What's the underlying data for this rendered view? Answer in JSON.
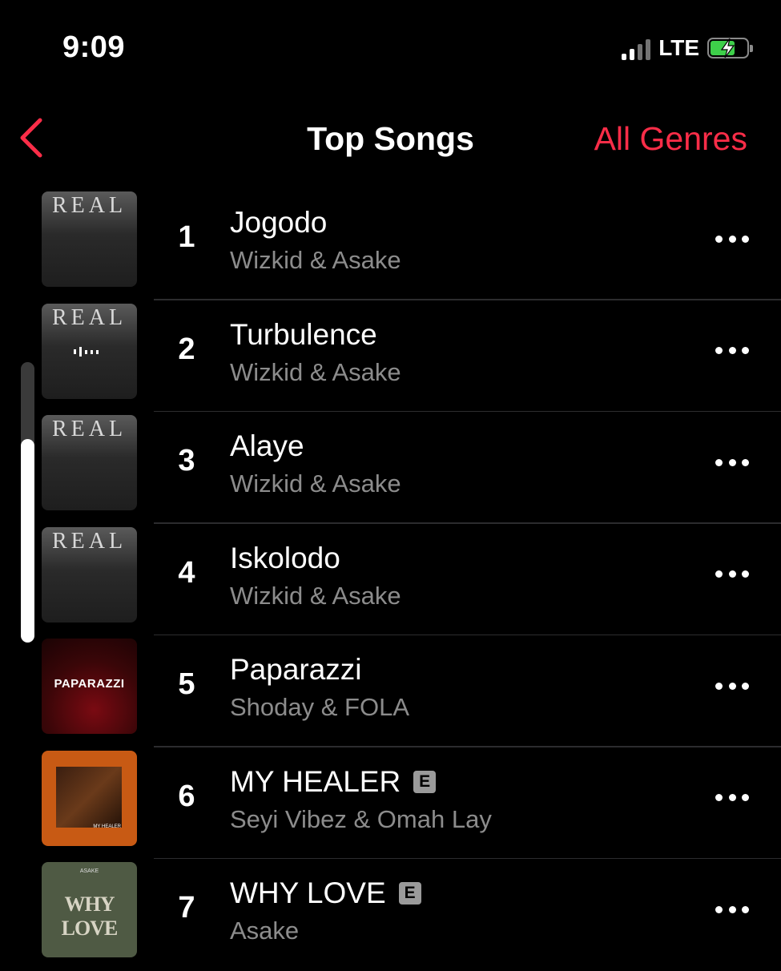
{
  "status": {
    "time": "9:09",
    "network": "LTE"
  },
  "nav": {
    "title": "Top Songs",
    "genre_filter": "All Genres"
  },
  "songs": [
    {
      "rank": "1",
      "title": "Jogodo",
      "artist": "Wizkid & Asake",
      "explicit": false,
      "art": "REAL"
    },
    {
      "rank": "2",
      "title": "Turbulence",
      "artist": "Wizkid & Asake",
      "explicit": false,
      "art": "REAL"
    },
    {
      "rank": "3",
      "title": "Alaye",
      "artist": "Wizkid & Asake",
      "explicit": false,
      "art": "REAL"
    },
    {
      "rank": "4",
      "title": "Iskolodo",
      "artist": "Wizkid & Asake",
      "explicit": false,
      "art": "REAL"
    },
    {
      "rank": "5",
      "title": "Paparazzi",
      "artist": "Shoday & FOLA",
      "explicit": false,
      "art": "PAPARAZZI"
    },
    {
      "rank": "6",
      "title": "MY HEALER",
      "artist": "Seyi Vibez & Omah Lay",
      "explicit": true,
      "explicit_label": "E",
      "art": "MY HEALER"
    },
    {
      "rank": "7",
      "title": "WHY LOVE",
      "artist": "Asake",
      "explicit": true,
      "explicit_label": "E",
      "art": "WHY LOVE",
      "art_caption": "ASAKE"
    }
  ],
  "colors": {
    "accent": "#fa2d48",
    "secondary_text": "#8c8c8c",
    "battery": "#3ecf4a"
  },
  "icons": [
    "back-chevron-icon",
    "more-icon",
    "signal-icon",
    "battery-charging-icon",
    "explicit-badge"
  ],
  "scroll": {
    "position_fraction": 0.27
  }
}
